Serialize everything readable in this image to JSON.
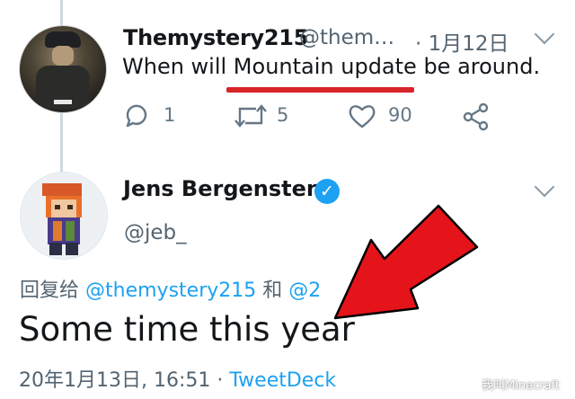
{
  "parent_tweet": {
    "display_name": "Themystery215",
    "handle": "@them…",
    "date": "· 1月12日",
    "text": "When will Mountain update be around.",
    "reply_count": "1",
    "retweet_count": "5",
    "like_count": "90"
  },
  "main_tweet": {
    "display_name": "Jens Bergensten",
    "handle": "@jeb_",
    "reply_prefix": "回复给",
    "reply_mention_1": "@themystery215",
    "reply_conjunction": "和",
    "reply_mention_2": "@2",
    "text": "Some time this year",
    "timestamp": "20年1月13日, 16:51",
    "separator": "·",
    "source": "TweetDeck"
  },
  "watermark": "我叫Minecraft",
  "colors": {
    "link": "#1da1f2",
    "annotation": "#e5141b",
    "secondary_text": "#536471"
  },
  "icons": [
    "reply-icon",
    "retweet-icon",
    "like-icon",
    "share-icon",
    "verified-badge-icon",
    "chevron-down-icon",
    "red-arrow-annotation"
  ]
}
